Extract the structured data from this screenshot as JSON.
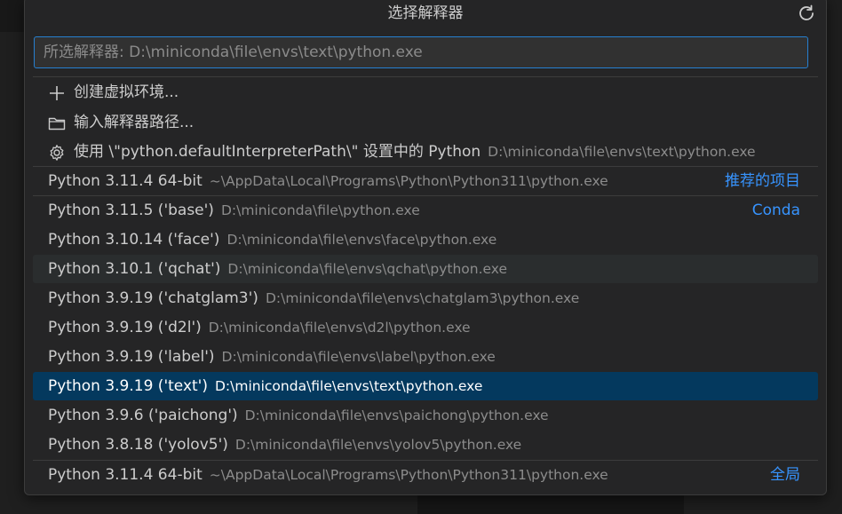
{
  "quickpick": {
    "title": "选择解释器",
    "search_placeholder": "所选解释器: D:\\miniconda\\file\\envs\\text\\python.exe"
  },
  "actions": [
    {
      "icon": "plus-icon",
      "label": "创建虚拟环境..."
    },
    {
      "icon": "folder-icon",
      "label": "输入解释器路径..."
    },
    {
      "icon": "gear-icon",
      "label": "使用 \\\"python.defaultInterpreterPath\\\" 设置中的 Python",
      "desc": "D:\\miniconda\\file\\envs\\text\\python.exe"
    }
  ],
  "interpreters": [
    {
      "label": "Python 3.11.4 64-bit",
      "desc": "~\\AppData\\Local\\Programs\\Python\\Python311\\python.exe",
      "tag": "推荐的项目"
    },
    {
      "label": "Python 3.11.5 ('base')",
      "desc": "D:\\miniconda\\file\\python.exe",
      "tag": "Conda"
    },
    {
      "label": "Python 3.10.14 ('face')",
      "desc": "D:\\miniconda\\file\\envs\\face\\python.exe",
      "tag": ""
    },
    {
      "label": "Python 3.10.1 ('qchat')",
      "desc": "D:\\miniconda\\file\\envs\\qchat\\python.exe",
      "tag": ""
    },
    {
      "label": "Python 3.9.19 ('chatglam3')",
      "desc": "D:\\miniconda\\file\\envs\\chatglam3\\python.exe",
      "tag": ""
    },
    {
      "label": "Python 3.9.19 ('d2l')",
      "desc": "D:\\miniconda\\file\\envs\\d2l\\python.exe",
      "tag": ""
    },
    {
      "label": "Python 3.9.19 ('label')",
      "desc": "D:\\miniconda\\file\\envs\\label\\python.exe",
      "tag": ""
    },
    {
      "label": "Python 3.9.19 ('text')",
      "desc": "D:\\miniconda\\file\\envs\\text\\python.exe",
      "tag": ""
    },
    {
      "label": "Python 3.9.6 ('paichong')",
      "desc": "D:\\miniconda\\file\\envs\\paichong\\python.exe",
      "tag": ""
    },
    {
      "label": "Python 3.8.18 ('yolov5')",
      "desc": "D:\\miniconda\\file\\envs\\yolov5\\python.exe",
      "tag": ""
    },
    {
      "label": "Python 3.11.4 64-bit",
      "desc": "~\\AppData\\Local\\Programs\\Python\\Python311\\python.exe",
      "tag": "全局"
    }
  ],
  "colors": {
    "accent": "#3794ff",
    "selected_bg": "#04395e",
    "focus_border": "#2680d0"
  }
}
